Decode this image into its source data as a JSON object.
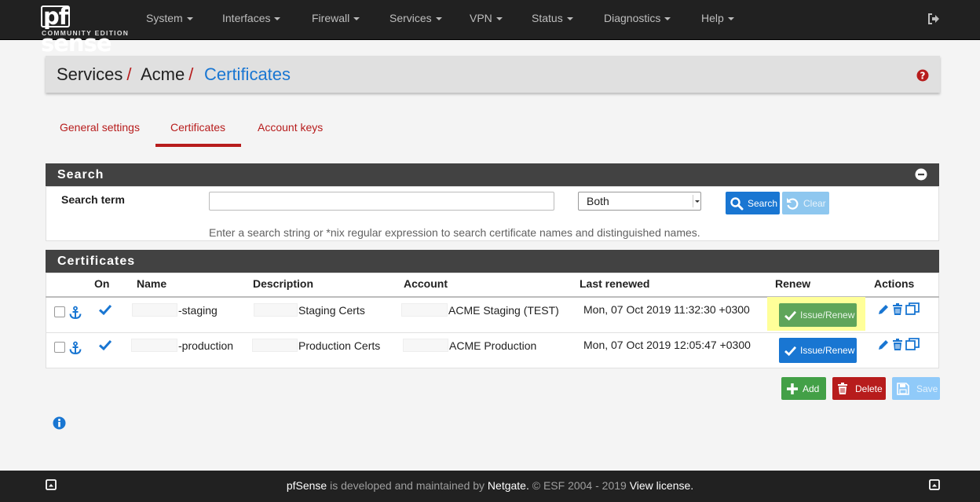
{
  "brand": {
    "name_prefix": "pf",
    "name_rest": "sense",
    "edition": "COMMUNITY EDITION"
  },
  "nav": {
    "items": [
      {
        "label": "System"
      },
      {
        "label": "Interfaces"
      },
      {
        "label": "Firewall"
      },
      {
        "label": "Services"
      },
      {
        "label": "VPN"
      },
      {
        "label": "Status"
      },
      {
        "label": "Diagnostics"
      },
      {
        "label": "Help"
      }
    ],
    "logout_icon": "sign-out-icon"
  },
  "breadcrumb": {
    "items": [
      {
        "label": "Services",
        "sep": "/"
      },
      {
        "label": "Acme",
        "sep": "/"
      },
      {
        "label": "Certificates"
      }
    ],
    "help_icon": "question-circle-icon"
  },
  "tabs": [
    {
      "label": "General settings",
      "active": false
    },
    {
      "label": "Certificates",
      "active": true
    },
    {
      "label": "Account keys",
      "active": false
    }
  ],
  "search": {
    "panel_title": "Search",
    "term_label": "Search term",
    "term_value": "",
    "select_value": "Both",
    "search_button": "Search",
    "clear_button": "Clear",
    "help_text": "Enter a search string or *nix regular expression to search certificate names and distinguished names."
  },
  "certificates": {
    "panel_title": "Certificates",
    "columns": [
      "On",
      "Name",
      "Description",
      "Account",
      "Last renewed",
      "Renew",
      "Actions"
    ],
    "rows": [
      {
        "checked": false,
        "on": true,
        "name": "-staging",
        "description": "Staging Certs",
        "account": "ACME Staging (TEST)",
        "last_renewed": "Mon, 07 Oct 2019 11:32:30 +0300",
        "renew_label": "Issue/Renew",
        "renew_state": "disabled-highlighted"
      },
      {
        "checked": false,
        "on": true,
        "name": "-production",
        "description": "Production Certs",
        "account": "ACME Production",
        "last_renewed": "Mon, 07 Oct 2019 12:05:47 +0300",
        "renew_label": "Issue/Renew",
        "renew_state": "active"
      }
    ],
    "buttons": {
      "add": "Add",
      "delete": "Delete",
      "save": "Save"
    }
  },
  "info_icon": "info-circle-icon",
  "footer": {
    "brand": "pfSense",
    "middle": " is developed and maintained by ",
    "company": "Netgate.",
    "copyright": " © ESF 2004 - 2019 ",
    "license": "View license."
  },
  "colors": {
    "navbar": "#212121",
    "accent_red": "#b71c1c",
    "link_blue": "#1976d2",
    "panel_heading": "#424242",
    "button_blue": "#1976d2",
    "button_green": "#43a047",
    "button_green_light": "#5fa55a",
    "button_red": "#b71c1c",
    "highlight_yellow": "#ffff99"
  }
}
